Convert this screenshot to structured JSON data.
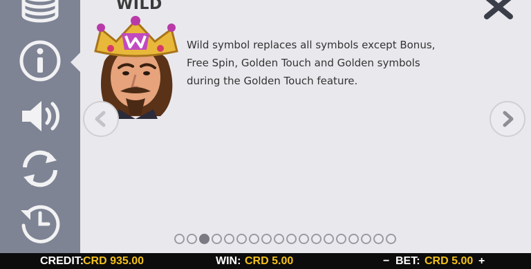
{
  "sidebar": {
    "buttons": [
      {
        "name": "coin-stack-icon"
      },
      {
        "name": "info-icon"
      },
      {
        "name": "speaker-icon"
      },
      {
        "name": "autoplay-icon"
      },
      {
        "name": "history-icon"
      }
    ]
  },
  "panel": {
    "title": "WILD",
    "description": "Wild symbol replaces all symbols except Bonus, Free Spin, Golden Touch and Golden symbols during the Golden Touch feature.",
    "symbol_icon": "king-wild-symbol",
    "pagination": {
      "total": 18,
      "active": 3
    }
  },
  "colors": {
    "accent": "#f4c21a",
    "footer_bg": "#0c0c0c",
    "sidebar_bg": "#7e8494"
  },
  "footer": {
    "credit_label": "CREDIT:",
    "credit_value": "CRD 935.00",
    "win_label": "WIN:",
    "win_value": "CRD 5.00",
    "bet_minus": "−",
    "bet_label": "BET:",
    "bet_value": "CRD 5.00",
    "bet_plus": "+"
  }
}
